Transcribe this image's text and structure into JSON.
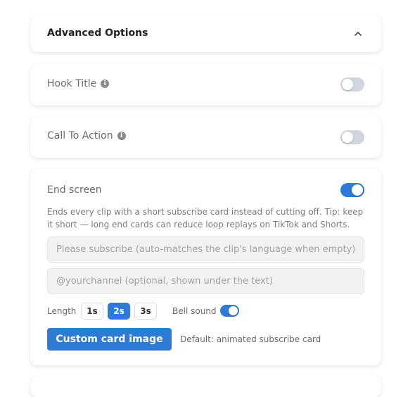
{
  "advanced": {
    "title": "Advanced Options",
    "expanded": true
  },
  "hook_title": {
    "label": "Hook Title",
    "enabled": false
  },
  "call_to_action": {
    "label": "Call To Action",
    "enabled": false
  },
  "end_screen": {
    "label": "End screen",
    "enabled": true,
    "description": "Ends every clip with a short subscribe card instead of cutting off. Tip: keep it short — long end cards can reduce loop replays on TikTok and Shorts.",
    "text_placeholder": "Please subscribe (auto-matches the clip's language when empty)",
    "channel_placeholder": "@yourchannel (optional, shown under the text)",
    "length_label": "Length",
    "length_options": [
      "1s",
      "2s",
      "3s"
    ],
    "length_selected": "2s",
    "bell_label": "Bell sound",
    "bell_enabled": true,
    "custom_image_button": "Custom card image",
    "default_note": "Default: animated subscribe card"
  },
  "colors": {
    "accent": "#2e7bd6",
    "toggle_off": "#cfd6de"
  },
  "icons": {
    "chevron": "chevron-up-icon",
    "info": "info-icon"
  }
}
